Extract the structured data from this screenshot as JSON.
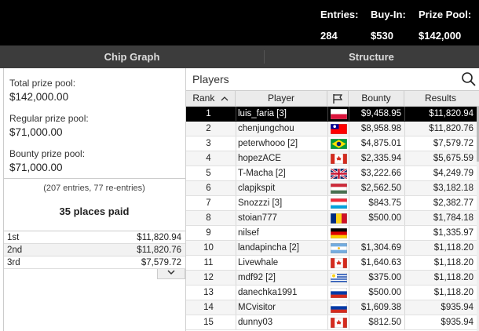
{
  "header": {
    "entries": {
      "label": "Entries:",
      "value": "284"
    },
    "buyin": {
      "label": "Buy-In:",
      "value": "$530"
    },
    "prize_pool": {
      "label": "Prize Pool:",
      "value": "$142,000"
    }
  },
  "tabs": {
    "chip_graph": "Chip Graph",
    "structure": "Structure"
  },
  "prizes": {
    "total_label": "Total prize pool:",
    "total_value": "$142,000.00",
    "regular_label": "Regular prize pool:",
    "regular_value": "$71,000.00",
    "bounty_label": "Bounty prize pool:",
    "bounty_value": "$71,000.00",
    "entries_note": "(207 entries, 77 re-entries)",
    "places_paid": "35 places paid"
  },
  "payouts": [
    {
      "place": "1st",
      "amount": "$11,820.94"
    },
    {
      "place": "2nd",
      "amount": "$11,820.76"
    },
    {
      "place": "3rd",
      "amount": "$7,579.72"
    }
  ],
  "players": {
    "title": "Players",
    "columns": {
      "rank": "Rank",
      "player": "Player",
      "bounty": "Bounty",
      "results": "Results"
    },
    "rows": [
      {
        "rank": "1",
        "name": "luis_faria [3]",
        "flag": "poland-flag",
        "bounty": "$9,458.95",
        "result": "$11,820.94"
      },
      {
        "rank": "2",
        "name": "chenjungchou",
        "flag": "taiwan-flag",
        "bounty": "$8,958.98",
        "result": "$11,820.76"
      },
      {
        "rank": "3",
        "name": "peterwhooo [2]",
        "flag": "brazil-flag",
        "bounty": "$4,875.01",
        "result": "$7,579.72"
      },
      {
        "rank": "4",
        "name": "hopezACE",
        "flag": "canada-flag",
        "bounty": "$2,335.94",
        "result": "$5,675.59"
      },
      {
        "rank": "5",
        "name": "T-Macha [2]",
        "flag": "uk-flag",
        "bounty": "$3,222.66",
        "result": "$4,249.79"
      },
      {
        "rank": "6",
        "name": "clapjkspit",
        "flag": "hungary-flag",
        "bounty": "$2,562.50",
        "result": "$3,182.18"
      },
      {
        "rank": "7",
        "name": "Snozzzi [3]",
        "flag": "luxembourg-flag",
        "bounty": "$843.75",
        "result": "$2,382.77"
      },
      {
        "rank": "8",
        "name": "stoian777",
        "flag": "romania-flag",
        "bounty": "$500.00",
        "result": "$1,784.18"
      },
      {
        "rank": "9",
        "name": "nilsef",
        "flag": "germany-flag",
        "bounty": "",
        "result": "$1,335.97"
      },
      {
        "rank": "10",
        "name": "landapincha [2]",
        "flag": "argentina-flag",
        "bounty": "$1,304.69",
        "result": "$1,118.20"
      },
      {
        "rank": "11",
        "name": "Livewhale",
        "flag": "canada-flag",
        "bounty": "$1,640.63",
        "result": "$1,118.20"
      },
      {
        "rank": "12",
        "name": "mdf92 [2]",
        "flag": "uruguay-flag",
        "bounty": "$375.00",
        "result": "$1,118.20"
      },
      {
        "rank": "13",
        "name": "danechka1991",
        "flag": "russia-flag",
        "bounty": "$500.00",
        "result": "$1,118.20"
      },
      {
        "rank": "14",
        "name": "MCvisitor",
        "flag": "russia-flag",
        "bounty": "$1,609.38",
        "result": "$935.94"
      },
      {
        "rank": "15",
        "name": "dunny03",
        "flag": "canada-flag",
        "bounty": "$812.50",
        "result": "$935.94"
      }
    ]
  },
  "colors": {
    "header_bg": "#000000",
    "tab_bg": "#3c3c3c",
    "selected_row": "#000000"
  }
}
